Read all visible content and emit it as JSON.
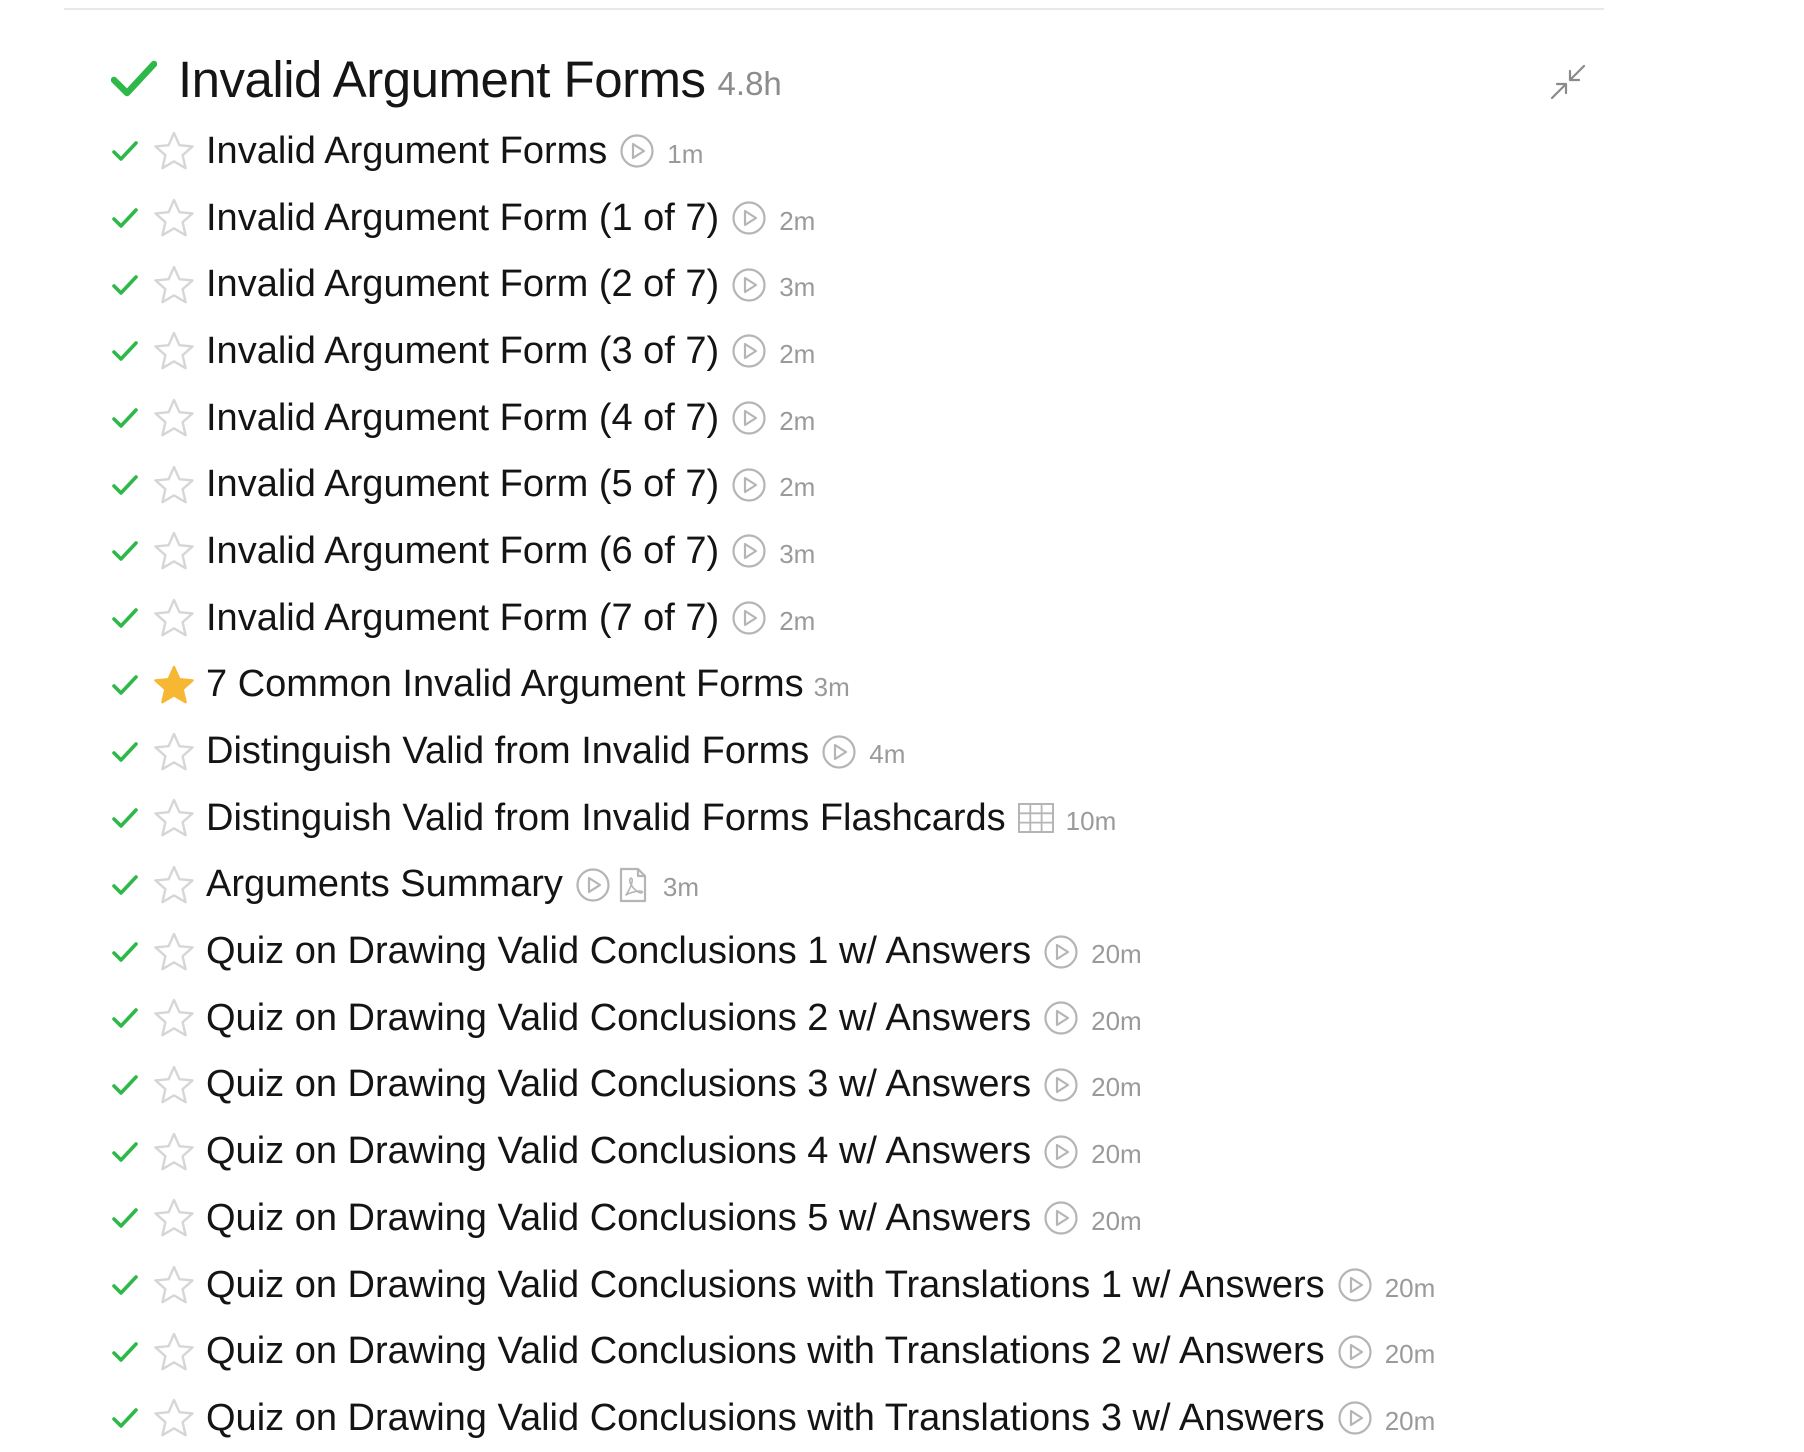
{
  "colors": {
    "check": "#2fb84a",
    "star_filled": "#f6b733",
    "star_outline": "#d6d6d6",
    "icon_gray": "#b5b5b5",
    "duration_gray": "#9a9a9a"
  },
  "section": {
    "title": "Invalid Argument Forms",
    "duration": "4.8h",
    "completed": true,
    "icon": "checkmark-icon",
    "collapse_icon": "collapse-arrows-icon"
  },
  "lessons": [
    {
      "title": "Invalid Argument Forms",
      "icons": [
        "video"
      ],
      "duration": "1m",
      "starred": false,
      "completed": true
    },
    {
      "title": "Invalid Argument Form (1 of 7)",
      "icons": [
        "video"
      ],
      "duration": "2m",
      "starred": false,
      "completed": true
    },
    {
      "title": "Invalid Argument Form (2 of 7)",
      "icons": [
        "video"
      ],
      "duration": "3m",
      "starred": false,
      "completed": true
    },
    {
      "title": "Invalid Argument Form (3 of 7)",
      "icons": [
        "video"
      ],
      "duration": "2m",
      "starred": false,
      "completed": true
    },
    {
      "title": "Invalid Argument Form (4 of 7)",
      "icons": [
        "video"
      ],
      "duration": "2m",
      "starred": false,
      "completed": true
    },
    {
      "title": "Invalid Argument Form (5 of 7)",
      "icons": [
        "video"
      ],
      "duration": "2m",
      "starred": false,
      "completed": true
    },
    {
      "title": "Invalid Argument Form (6 of 7)",
      "icons": [
        "video"
      ],
      "duration": "3m",
      "starred": false,
      "completed": true
    },
    {
      "title": "Invalid Argument Form (7 of 7)",
      "icons": [
        "video"
      ],
      "duration": "2m",
      "starred": false,
      "completed": true
    },
    {
      "title": "7 Common Invalid Argument Forms",
      "icons": [],
      "duration": "3m",
      "starred": true,
      "completed": true
    },
    {
      "title": "Distinguish Valid from Invalid Forms",
      "icons": [
        "video"
      ],
      "duration": "4m",
      "starred": false,
      "completed": true
    },
    {
      "title": "Distinguish Valid from Invalid Forms Flashcards",
      "icons": [
        "flashcards"
      ],
      "duration": "10m",
      "starred": false,
      "completed": true
    },
    {
      "title": "Arguments Summary",
      "icons": [
        "video",
        "pdf"
      ],
      "duration": "3m",
      "starred": false,
      "completed": true
    },
    {
      "title": "Quiz on Drawing Valid Conclusions 1 w/ Answers",
      "icons": [
        "video"
      ],
      "duration": "20m",
      "starred": false,
      "completed": true
    },
    {
      "title": "Quiz on Drawing Valid Conclusions 2 w/ Answers",
      "icons": [
        "video"
      ],
      "duration": "20m",
      "starred": false,
      "completed": true
    },
    {
      "title": "Quiz on Drawing Valid Conclusions 3 w/ Answers",
      "icons": [
        "video"
      ],
      "duration": "20m",
      "starred": false,
      "completed": true
    },
    {
      "title": "Quiz on Drawing Valid Conclusions 4 w/ Answers",
      "icons": [
        "video"
      ],
      "duration": "20m",
      "starred": false,
      "completed": true
    },
    {
      "title": "Quiz on Drawing Valid Conclusions 5 w/ Answers",
      "icons": [
        "video"
      ],
      "duration": "20m",
      "starred": false,
      "completed": true
    },
    {
      "title": "Quiz on Drawing Valid Conclusions with Translations 1 w/ Answers",
      "icons": [
        "video"
      ],
      "duration": "20m",
      "starred": false,
      "completed": true
    },
    {
      "title": "Quiz on Drawing Valid Conclusions with Translations 2 w/ Answers",
      "icons": [
        "video"
      ],
      "duration": "20m",
      "starred": false,
      "completed": true
    },
    {
      "title": "Quiz on Drawing Valid Conclusions with Translations 3 w/ Answers",
      "icons": [
        "video"
      ],
      "duration": "20m",
      "starred": false,
      "completed": true
    }
  ]
}
